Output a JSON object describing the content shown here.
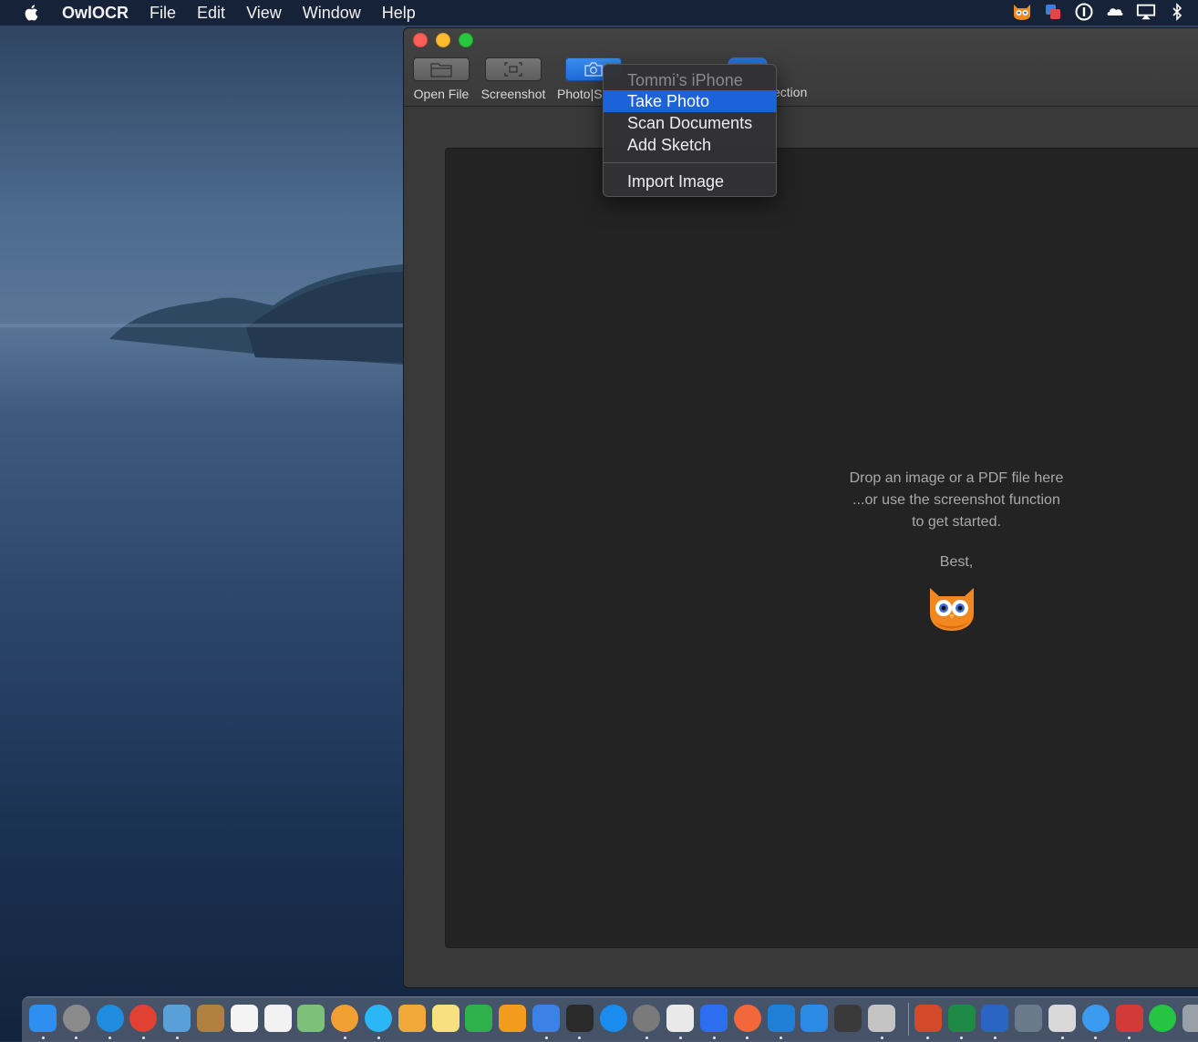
{
  "menubar": {
    "app_name": "OwlOCR",
    "items": [
      "File",
      "Edit",
      "View",
      "Window",
      "Help"
    ],
    "status_icons": [
      "owl-icon",
      "screen-share-icon",
      "password-icon",
      "onedrive-icon",
      "airplay-icon",
      "bluetooth-icon"
    ]
  },
  "toolbar": {
    "open_file": "Open File",
    "screenshot": "Screenshot",
    "photo": "Photo|S",
    "detection_partial": "ection"
  },
  "menu": {
    "header": "Tommi’s iPhone",
    "items": [
      "Take Photo",
      "Scan Documents",
      "Add Sketch"
    ],
    "import": "Import Image"
  },
  "content": {
    "line1": "Drop an image or a PDF file here",
    "line2": "...or use the screenshot function",
    "line3": "to get started.",
    "sign": "Best,"
  },
  "dock": {
    "apps": [
      {
        "name": "finder-icon",
        "color": "#2f8ff0"
      },
      {
        "name": "launchpad-icon",
        "color": "#8a8a8a"
      },
      {
        "name": "safari-icon",
        "color": "#1f8ce0"
      },
      {
        "name": "chrome-icon",
        "color": "#e14133"
      },
      {
        "name": "preview-icon",
        "color": "#5aa0d8"
      },
      {
        "name": "notefile-icon",
        "color": "#b08040"
      },
      {
        "name": "calendar-icon",
        "color": "#f4f4f4"
      },
      {
        "name": "reminders-icon",
        "color": "#f2f2f2"
      },
      {
        "name": "maps-icon",
        "color": "#7cc07a"
      },
      {
        "name": "photos-icon",
        "color": "#f0a030"
      },
      {
        "name": "messages-icon",
        "color": "#2bb7f5"
      },
      {
        "name": "pages-icon",
        "color": "#f0a838"
      },
      {
        "name": "notes-icon",
        "color": "#f6e080"
      },
      {
        "name": "numbers-icon",
        "color": "#2eb14a"
      },
      {
        "name": "books-icon",
        "color": "#f29b1d"
      },
      {
        "name": "keynote-icon",
        "color": "#3c82e6"
      },
      {
        "name": "terminal-icon",
        "color": "#2a2a2a"
      },
      {
        "name": "app-store-icon",
        "color": "#1a8cf0"
      },
      {
        "name": "system-preferences-icon",
        "color": "#7a7a7a"
      },
      {
        "name": "slack-icon",
        "color": "#e9e9e9"
      },
      {
        "name": "signal-icon",
        "color": "#2d6df0"
      },
      {
        "name": "swift-playgrounds-icon",
        "color": "#f2683a"
      },
      {
        "name": "vscode-icon",
        "color": "#1f7fd6"
      },
      {
        "name": "xcode-icon",
        "color": "#2a8ae4"
      },
      {
        "name": "activity-monitor-icon",
        "color": "#3a3a3a"
      },
      {
        "name": "archive-utility-icon",
        "color": "#c4c4c4"
      },
      {
        "name": "powerpoint-icon",
        "color": "#d24a2a"
      },
      {
        "name": "excel-icon",
        "color": "#1e8a46"
      },
      {
        "name": "word-icon",
        "color": "#2b65c4"
      },
      {
        "name": "security-icon",
        "color": "#6a7a8a"
      },
      {
        "name": "bbedit-icon",
        "color": "#d8d8d8"
      },
      {
        "name": "things-icon",
        "color": "#3a9bf0"
      },
      {
        "name": "screens-icon",
        "color": "#d23a3a"
      },
      {
        "name": "whatsapp-icon",
        "color": "#25c443"
      },
      {
        "name": "trash-icon",
        "color": "#9aa0a8"
      }
    ]
  }
}
